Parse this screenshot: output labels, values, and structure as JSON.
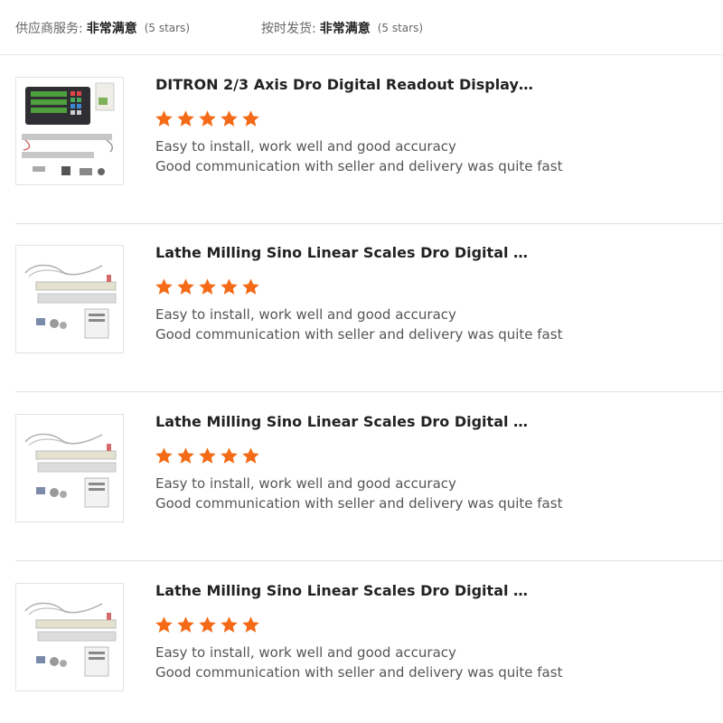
{
  "header": {
    "supplier_service": {
      "label": "供应商服务:",
      "value": "非常满意",
      "note": "(5 stars)"
    },
    "on_time_shipping": {
      "label": "按时发货:",
      "value": "非常满意",
      "note": "(5 stars)"
    }
  },
  "colors": {
    "star": "#f46a16",
    "divider": "#e0e0e0"
  },
  "reviews": [
    {
      "title": "DITRON 2/3 Axis Dro Digital Readout Display w...",
      "rating": 5,
      "image": "dro-display-kit-photo",
      "lines": [
        "Easy to install, work well and good accuracy",
        "Good communication with seller and delivery was quite fast"
      ]
    },
    {
      "title": "Lathe Milling Sino Linear Scales Dro Digital Sc...",
      "rating": 5,
      "image": "linear-scale-kit-photo",
      "lines": [
        "Easy to install, work well and good accuracy",
        "Good communication with seller and delivery was quite fast"
      ]
    },
    {
      "title": "Lathe Milling Sino Linear Scales Dro Digital Sc...",
      "rating": 5,
      "image": "linear-scale-kit-photo",
      "lines": [
        "Easy to install, work well and good accuracy",
        "Good communication with seller and delivery was quite fast"
      ]
    },
    {
      "title": "Lathe Milling Sino Linear Scales Dro Digital Sc...",
      "rating": 5,
      "image": "linear-scale-kit-photo",
      "lines": [
        "Easy to install, work well and good accuracy",
        "Good communication with seller and delivery was quite fast"
      ]
    }
  ]
}
